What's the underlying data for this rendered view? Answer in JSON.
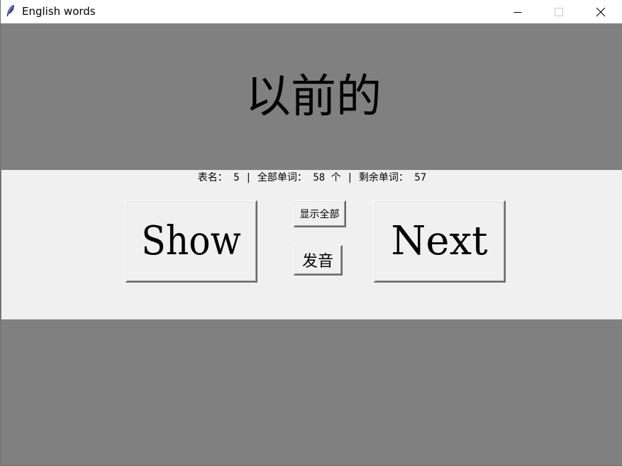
{
  "window": {
    "title": "English words",
    "icon": "feather-icon",
    "controls": [
      "minimize-icon",
      "maximize-icon",
      "close-icon"
    ]
  },
  "word": {
    "text": "以前的"
  },
  "stats": {
    "text": "表名： 5 | 全部单词： 58 个 | 剩余单词： 57"
  },
  "buttons": {
    "show": "Show",
    "next": "Next",
    "show_all": "显示全部",
    "pronounce": "发音"
  },
  "colors": {
    "background": "#808080",
    "panel": "#f0f0f0",
    "titlebar": "#ffffff"
  }
}
